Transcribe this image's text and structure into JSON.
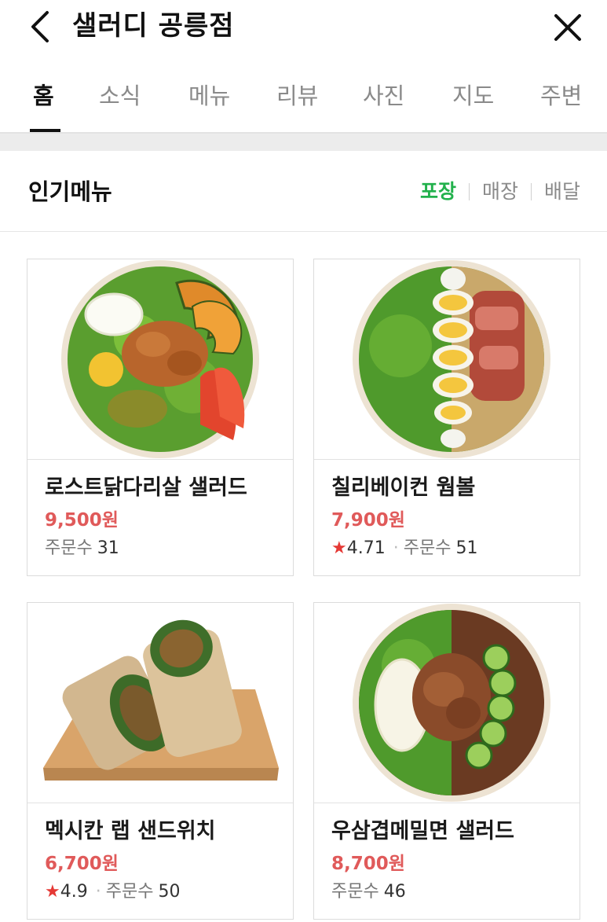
{
  "header": {
    "title": "샐러디 공릉점",
    "back_icon": "chevron-left-icon",
    "close_icon": "close-icon"
  },
  "tabs": [
    {
      "label": "홈",
      "active": true
    },
    {
      "label": "소식"
    },
    {
      "label": "메뉴"
    },
    {
      "label": "리뷰"
    },
    {
      "label": "사진"
    },
    {
      "label": "지도"
    },
    {
      "label": "주변"
    }
  ],
  "section": {
    "title": "인기메뉴",
    "filters": [
      {
        "label": "포장",
        "active": true
      },
      {
        "label": "매장"
      },
      {
        "label": "배달"
      }
    ]
  },
  "colors": {
    "accent_green": "#22b14c",
    "price_red": "#e05a5a",
    "star_red": "#e53935"
  },
  "menu": [
    {
      "name": "로스트닭다리살 샐러드",
      "price": "9,500원",
      "rating": "",
      "orders_label": "주문수",
      "orders": "31",
      "image": "salad-bowl-chicken"
    },
    {
      "name": "칠리베이컨 웜볼",
      "price": "7,900원",
      "rating": "4.71",
      "orders_label": "주문수",
      "orders": "51",
      "image": "salad-bowl-bacon-egg"
    },
    {
      "name": "멕시칸 랩 샌드위치",
      "price": "6,700원",
      "rating": "4.9",
      "orders_label": "주문수",
      "orders": "50",
      "image": "wrap-sandwich"
    },
    {
      "name": "우삼겹메밀면 샐러드",
      "price": "8,700원",
      "rating": "",
      "orders_label": "주문수",
      "orders": "46",
      "image": "salad-bowl-beef-noodle"
    }
  ]
}
